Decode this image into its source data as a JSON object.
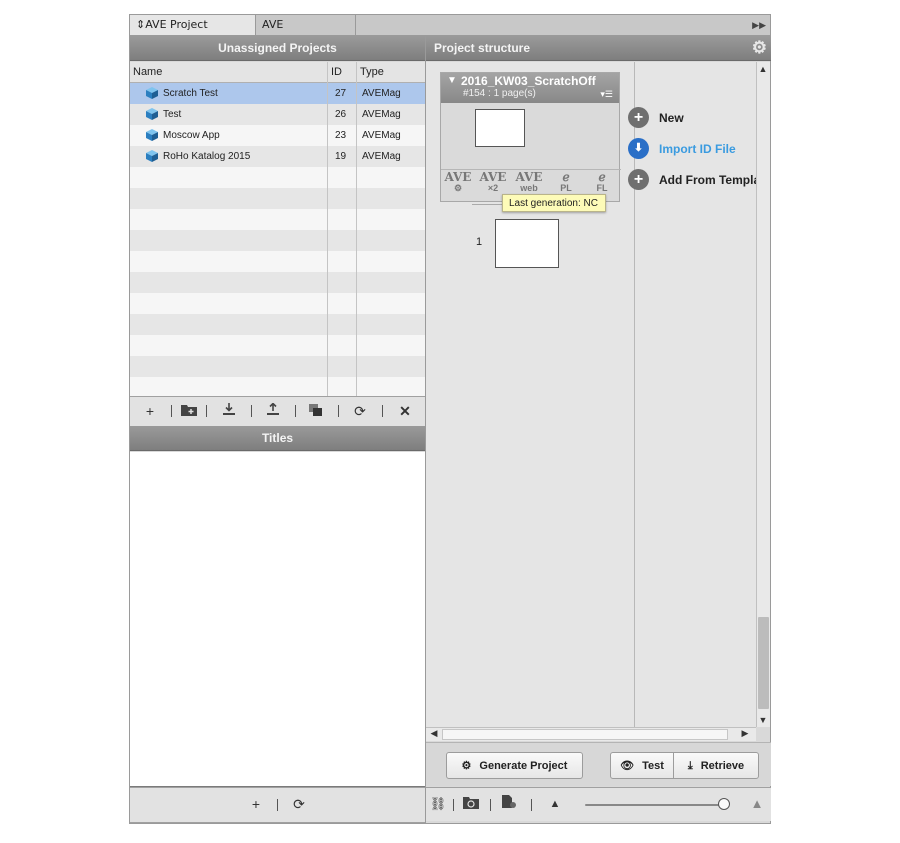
{
  "tabs": [
    {
      "label": "AVE Project Manager"
    },
    {
      "label": "AVE Interactivity"
    }
  ],
  "left": {
    "header": "Unassigned Projects",
    "columns": [
      "Name",
      "ID",
      "Type"
    ],
    "rows": [
      {
        "name": "Scratch Test",
        "id": "27",
        "type": "AVEMag",
        "selected": true
      },
      {
        "name": "Test",
        "id": "26",
        "type": "AVEMag",
        "selected": false
      },
      {
        "name": "Moscow App",
        "id": "23",
        "type": "AVEMag",
        "selected": false
      },
      {
        "name": "RoHo Katalog 2015",
        "id": "19",
        "type": "AVEMag",
        "selected": false
      }
    ],
    "titles_header": "Titles"
  },
  "right": {
    "header": "Project structure",
    "project": {
      "title": "2016_KW03_ScratchOff",
      "subtitle": "#154 : 1 page(s)",
      "tools": [
        {
          "top": "AVE",
          "bottom": "⚙"
        },
        {
          "top": "AVE",
          "bottom": "×2"
        },
        {
          "top": "AVE",
          "bottom": "web"
        },
        {
          "top": "ℯ",
          "bottom": "PL"
        },
        {
          "top": "ℯ",
          "bottom": "FL"
        }
      ]
    },
    "tooltip": "Last generation: NC",
    "page_number": "1",
    "actions": [
      {
        "label": "New",
        "icon": "plus-icon"
      },
      {
        "label": "Import ID File",
        "icon": "download-icon"
      },
      {
        "label": "Add From Templa",
        "icon": "plus-icon"
      }
    ],
    "buttons": {
      "generate": "Generate Project",
      "test": "Test",
      "retrieve": "Retrieve"
    }
  },
  "colors": {
    "header_gray": "#8a8a8a",
    "selected_row": "#adc7ec",
    "tooltip_bg": "#fdfbb8",
    "link_blue": "#3a9be0"
  }
}
